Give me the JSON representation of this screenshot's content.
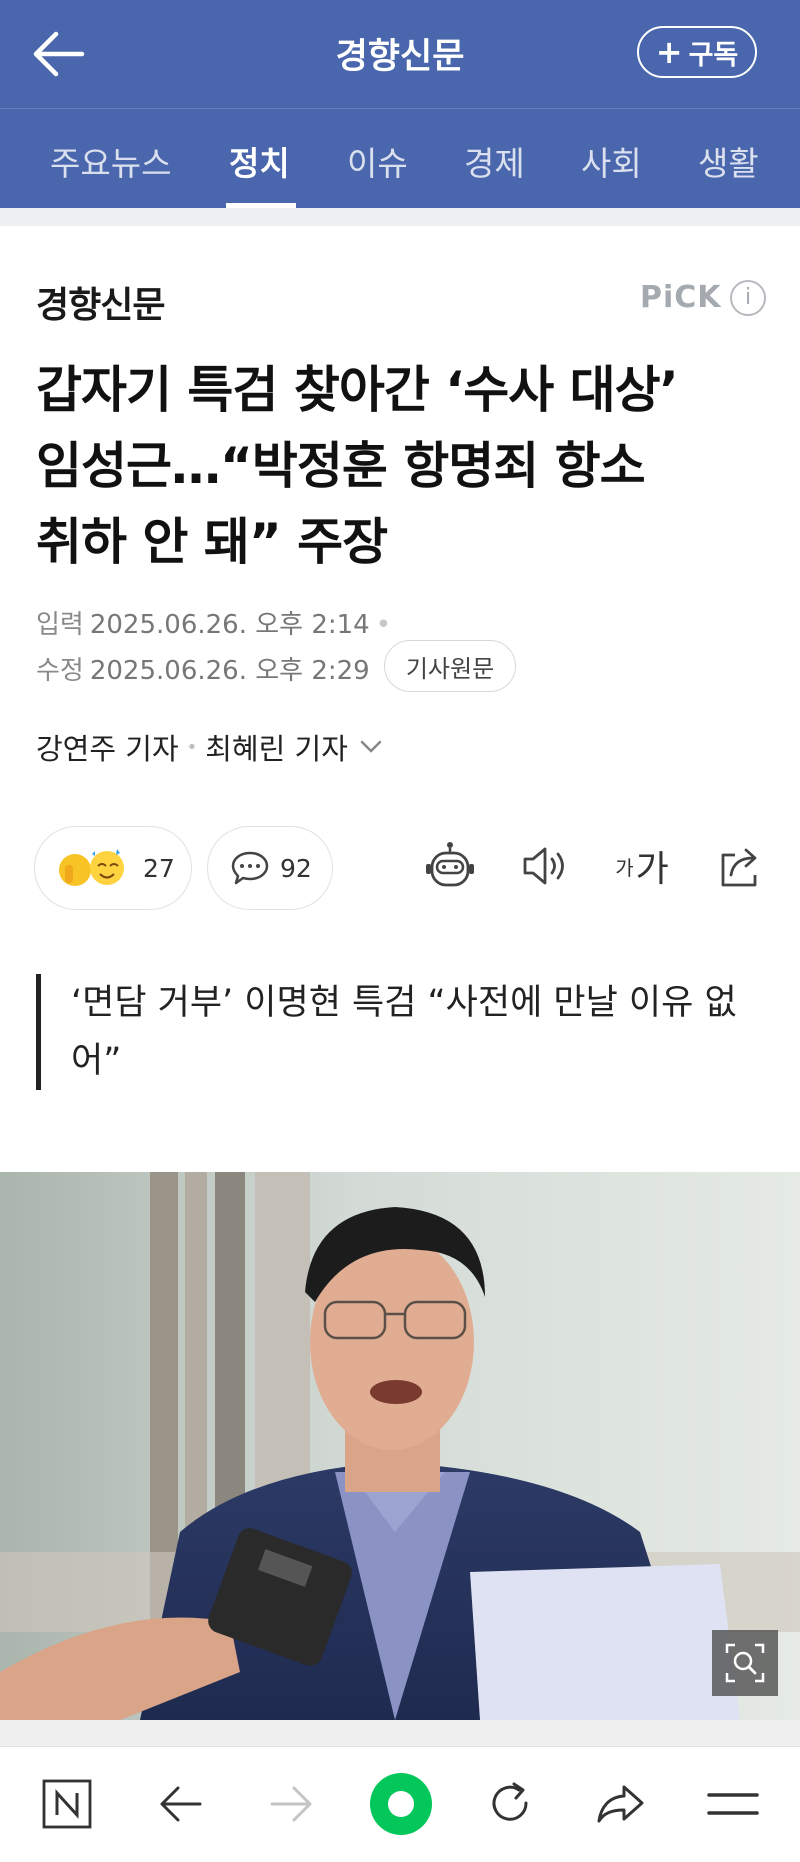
{
  "header": {
    "press_name": "경향신문",
    "subscribe_label": "구독"
  },
  "tabs": [
    {
      "label": "주요뉴스",
      "active": false
    },
    {
      "label": "정치",
      "active": true
    },
    {
      "label": "이슈",
      "active": false
    },
    {
      "label": "경제",
      "active": false
    },
    {
      "label": "사회",
      "active": false
    },
    {
      "label": "생활",
      "active": false
    }
  ],
  "article": {
    "press_logo": "경향신문",
    "pick_label": "PiCK",
    "pick_info": "i",
    "headline_lines": [
      "갑자기 특검 찾아간 ‘수사 대상’",
      "임성근…“박정훈 항명죄 항소",
      "취하 안 돼” 주장"
    ],
    "input_label": "입력",
    "input_time": "2025.06.26. 오후 2:14",
    "modified_label": "수정",
    "modified_time": "2025.06.26. 오후 2:29",
    "origin_button": "기사원문",
    "reporters": [
      "강연주 기자",
      "최혜린 기자"
    ],
    "reporter_separator": "•",
    "reaction_count": "27",
    "comment_count": "92",
    "fontsize_small": "가",
    "fontsize_large": "가",
    "subheadline": "‘면담 거부’ 이명현 특검 “사전에 만날 이유 없어”"
  },
  "icons": {
    "back": "arrow-left-icon",
    "summary": "robot-icon",
    "listen": "speaker-icon",
    "share": "share-icon",
    "zoom": "zoom-icon",
    "naver": "naver-n-icon",
    "green_dot": "green-dot-icon"
  },
  "colors": {
    "header_blue": "#4a66ac",
    "naver_green": "#03c75a"
  }
}
